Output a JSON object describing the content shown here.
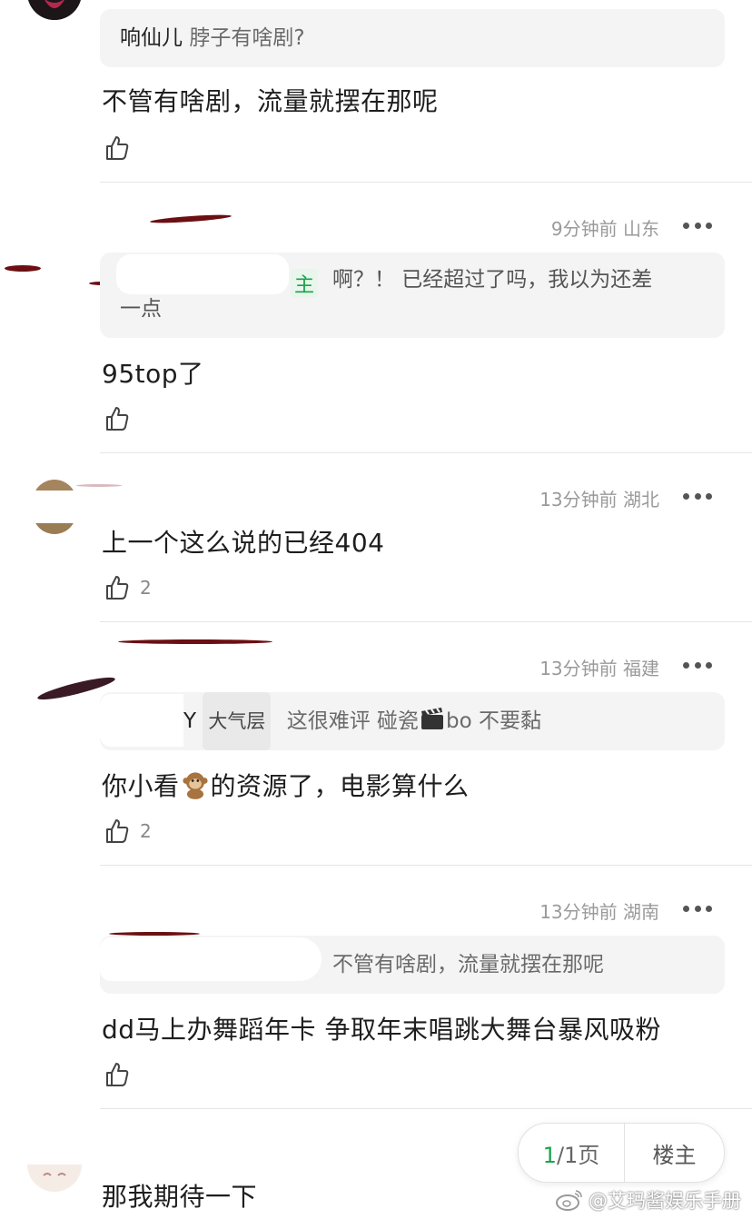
{
  "comments": [
    {
      "quote_author": "响仙儿",
      "quote_text": "脖子有啥剧?",
      "body": "不管有啥剧，流量就摆在那呢",
      "likes": ""
    },
    {
      "time": "9分钟前",
      "location": "山东",
      "badge": "主",
      "quote_text_line1": "啊？！ 已经超过了吗，我以为还差",
      "quote_text_line2": "一点",
      "body": "95top了",
      "likes": ""
    },
    {
      "time": "13分钟前",
      "location": "湖北",
      "body": "上一个这么说的已经404",
      "likes": "2"
    },
    {
      "time": "13分钟前",
      "location": "福建",
      "quote_author_tail": "Y",
      "quote_tag": "大气层",
      "quote_text_a": "这很难评 碰瓷",
      "quote_text_b": "bo 不要黏",
      "body_a": "你小看",
      "body_b": "的资源了，电影算什么",
      "likes": "2"
    },
    {
      "time": "13分钟前",
      "location": "湖南",
      "quote_text": "不管有啥剧，流量就摆在那呢",
      "body": "dd马上办舞蹈年卡 争取年末唱跳大舞台暴风吸粉",
      "likes": ""
    },
    {
      "body": "那我期待一下"
    }
  ],
  "pager": {
    "current": "1",
    "total_text": "/1页",
    "owner_label": "楼主"
  },
  "watermark": "@艾玛酱娱乐手册",
  "colors": {
    "accent_green": "#1aa34a",
    "quote_bg": "#f4f4f4",
    "meta_gray": "#9a9a9a"
  },
  "icons": [
    "thumbs-up-icon",
    "more-icon",
    "weibo-logo-icon"
  ]
}
